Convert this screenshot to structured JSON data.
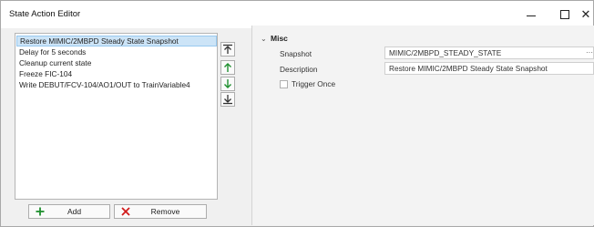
{
  "window": {
    "title": "State Action Editor",
    "minimize": "—",
    "maximize": "□",
    "close": "✕"
  },
  "actions_list": {
    "items": [
      {
        "label": "Restore MIMIC/2MBPD Steady State Snapshot",
        "selected": true
      },
      {
        "label": "Delay for 5 seconds",
        "selected": false
      },
      {
        "label": "Cleanup current state",
        "selected": false
      },
      {
        "label": "Freeze FIC-104",
        "selected": false
      },
      {
        "label": "Write DEBUT/FCV-104/AO1/OUT to TrainVariable4",
        "selected": false
      }
    ]
  },
  "reorder_buttons": [
    {
      "name": "move-to-top-button",
      "icon": "arrow-to-top-icon"
    },
    {
      "name": "move-up-button",
      "icon": "arrow-up-icon"
    },
    {
      "name": "move-down-button",
      "icon": "arrow-down-icon"
    },
    {
      "name": "move-to-bottom-button",
      "icon": "arrow-to-bottom-icon"
    }
  ],
  "buttons": {
    "add_label": "Add",
    "remove_label": "Remove"
  },
  "properties": {
    "category_chevron": "⌄",
    "category": "Misc",
    "snapshot_label": "Snapshot",
    "snapshot_value": "MIMIC/2MBPD_STEADY_STATE",
    "snapshot_ellipsis": "···",
    "description_label": "Description",
    "description_value": "Restore MIMIC/2MBPD Steady State Snapshot",
    "trigger_once_label": "Trigger Once",
    "trigger_once_checked": false
  },
  "colors": {
    "selection_bg": "#cce4f7",
    "arrow_green": "#1e8f2e",
    "remove_red": "#d11a1a"
  }
}
